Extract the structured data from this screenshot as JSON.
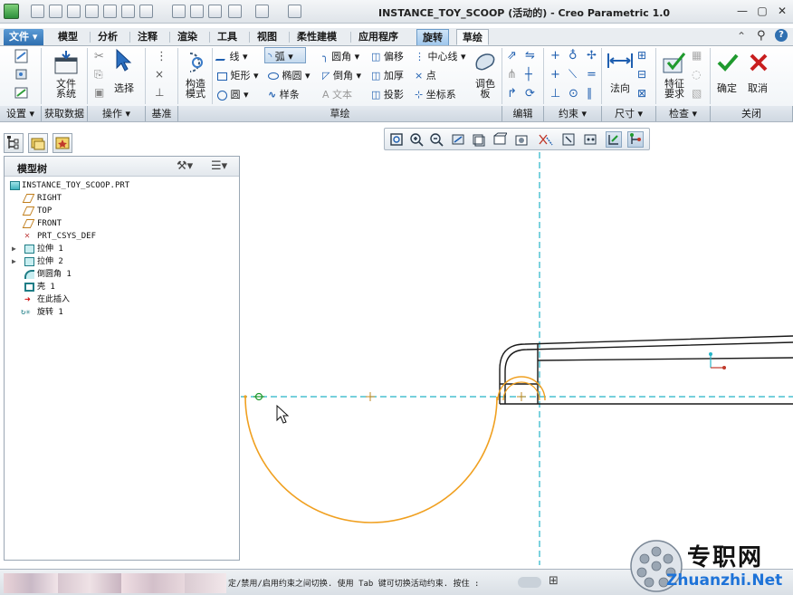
{
  "window": {
    "title": "INSTANCE_TOY_SCOOP (活动的) - Creo Parametric 1.0",
    "controls": [
      "—",
      "▢",
      "✕"
    ]
  },
  "menu_tabs": [
    {
      "label": "文件 ▾"
    },
    {
      "label": "模型"
    },
    {
      "label": "分析"
    },
    {
      "label": "注释"
    },
    {
      "label": "渲染"
    },
    {
      "label": "工具"
    },
    {
      "label": "视图"
    },
    {
      "label": "柔性建模"
    },
    {
      "label": "应用程序"
    },
    {
      "label": "旋转"
    },
    {
      "label": "草绘"
    }
  ],
  "ribbon": {
    "file_system": "文件\n系统",
    "select": "选择",
    "construct_mode": "构造\n模式",
    "line": "线",
    "arc": "弧",
    "rectangle": "矩形",
    "ellipse": "椭圆",
    "circle": "圆",
    "spline": "样条",
    "fillet": "圆角",
    "chamfer": "倒角",
    "text": "文本",
    "offset": "偏移",
    "thicken": "加厚",
    "project": "投影",
    "centerline": "中心线",
    "point": "点",
    "coordsys": "坐标系",
    "palette": "调色\n板",
    "normal": "法向",
    "feature_req": "特征\n要求",
    "ok": "确定",
    "cancel": "取消"
  },
  "ribbon_groups": [
    {
      "label": "设置 ▾"
    },
    {
      "label": "获取数据"
    },
    {
      "label": "操作 ▾"
    },
    {
      "label": "基准"
    },
    {
      "label": "草绘"
    },
    {
      "label": "编辑"
    },
    {
      "label": "约束 ▾"
    },
    {
      "label": "尺寸 ▾"
    },
    {
      "label": "检查 ▾"
    },
    {
      "label": "关闭"
    }
  ],
  "model_tree": {
    "title": "模型树",
    "items": [
      {
        "label": "INSTANCE_TOY_SCOOP.PRT",
        "icon": "part-icon"
      },
      {
        "label": "RIGHT",
        "icon": "datum-plane-icon"
      },
      {
        "label": "TOP",
        "icon": "datum-plane-icon"
      },
      {
        "label": "FRONT",
        "icon": "datum-plane-icon"
      },
      {
        "label": "PRT_CSYS_DEF",
        "icon": "csys-icon"
      },
      {
        "label": "拉伸 1",
        "icon": "extrude-icon",
        "expander": "▶"
      },
      {
        "label": "拉伸 2",
        "icon": "extrude-icon",
        "expander": "▶"
      },
      {
        "label": "倒圆角 1",
        "icon": "round-icon"
      },
      {
        "label": "壳 1",
        "icon": "shell-icon"
      },
      {
        "label": "在此插入",
        "icon": "insert-arrow-icon"
      },
      {
        "label": "旋转 1",
        "icon": "revolve-icon"
      }
    ]
  },
  "status": {
    "message": "定/禁用/启用约束之间切换. 使用 Tab 键可切换活动约束. 按住 :"
  },
  "watermark": {
    "cn": "专职网",
    "en": "Zhuanzhi.Net"
  },
  "colors": {
    "sketch_orange": "#f0a020",
    "centerline_cyan": "#25b5c8",
    "accent_blue": "#2f6fb0",
    "ok_green": "#1f9a2e",
    "cancel_red": "#c81e1e"
  }
}
